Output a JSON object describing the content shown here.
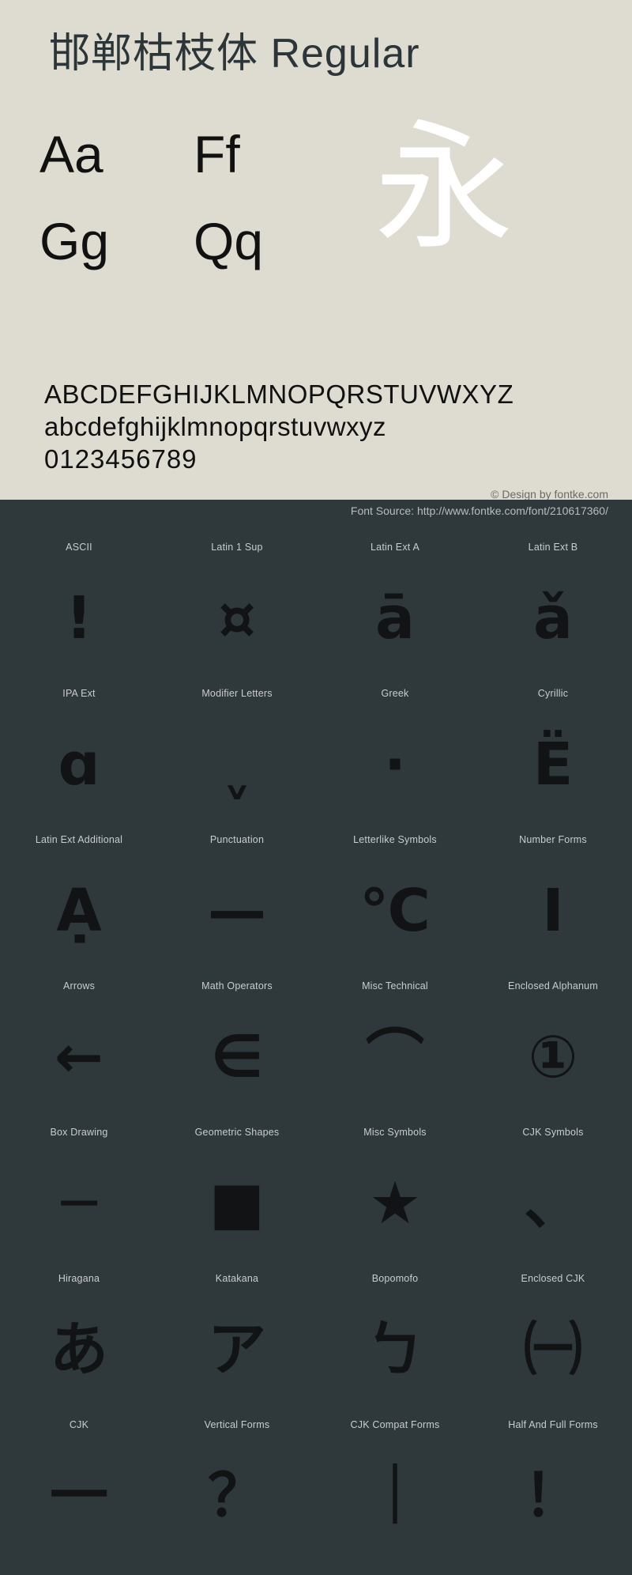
{
  "colors": {
    "light_bg": "#dedbd1",
    "dark_bg": "#2f383b",
    "glyph_dark": "#111315",
    "label_text": "#c9cdce",
    "credit_text": "#6a6a66",
    "showcase_glyph": "#ffffff"
  },
  "header": {
    "font_name": "邯郸枯枝体",
    "style_name": "Regular",
    "full_title": "邯郸枯枝体  Regular"
  },
  "samples": {
    "pairs": [
      "Aa",
      "Ff",
      "Gg",
      "Qq"
    ],
    "showcase_char": "永"
  },
  "alphabet": {
    "uppercase": "ABCDEFGHIJKLMNOPQRSTUVWXYZ",
    "lowercase": "abcdefghijklmnopqrstuvwxyz",
    "digits": "0123456789"
  },
  "credits": {
    "design": "© Design by fontke.com",
    "source": "Font Source: http://www.fontke.com/font/210617360/"
  },
  "unicode_blocks": [
    [
      {
        "label": "ASCII",
        "glyph": "!",
        "size": "normal"
      },
      {
        "label": "Latin 1 Sup",
        "glyph": "¤",
        "size": "normal"
      },
      {
        "label": "Latin Ext A",
        "glyph": "ā",
        "size": "normal"
      },
      {
        "label": "Latin Ext B",
        "glyph": "ǎ",
        "size": "normal"
      }
    ],
    [
      {
        "label": "IPA Ext",
        "glyph": "ɑ",
        "size": "normal"
      },
      {
        "label": "Modifier Letters",
        "glyph": "ˬ",
        "size": "normal"
      },
      {
        "label": "Greek",
        "glyph": "·",
        "size": "normal"
      },
      {
        "label": "Cyrillic",
        "glyph": "Ё",
        "size": "normal"
      }
    ],
    [
      {
        "label": "Latin Ext Additional",
        "glyph": "Ạ",
        "size": "normal"
      },
      {
        "label": "Punctuation",
        "glyph": "—",
        "size": "normal"
      },
      {
        "label": "Letterlike Symbols",
        "glyph": "℃",
        "size": "normal"
      },
      {
        "label": "Number Forms",
        "glyph": "Ⅰ",
        "size": "normal"
      }
    ],
    [
      {
        "label": "Arrows",
        "glyph": "←",
        "size": "normal"
      },
      {
        "label": "Math Operators",
        "glyph": "∈",
        "size": "normal"
      },
      {
        "label": "Misc Technical",
        "glyph": "⌒",
        "size": "normal"
      },
      {
        "label": "Enclosed Alphanum",
        "glyph": "①",
        "size": "normal"
      }
    ],
    [
      {
        "label": "Box Drawing",
        "glyph": "─",
        "size": "normal"
      },
      {
        "label": "Geometric Shapes",
        "glyph": "■",
        "size": "normal"
      },
      {
        "label": "Misc Symbols",
        "glyph": "★",
        "size": "normal"
      },
      {
        "label": "CJK Symbols",
        "glyph": "、",
        "size": "normal"
      }
    ],
    [
      {
        "label": "Hiragana",
        "glyph": "あ",
        "size": "normal"
      },
      {
        "label": "Katakana",
        "glyph": "ア",
        "size": "normal"
      },
      {
        "label": "Bopomofo",
        "glyph": "ㄅ",
        "size": "normal"
      },
      {
        "label": "Enclosed CJK",
        "glyph": "㈠",
        "size": "normal"
      }
    ],
    [
      {
        "label": "CJK",
        "glyph": "一",
        "size": "normal"
      },
      {
        "label": "Vertical Forms",
        "glyph": "？",
        "size": "normal"
      },
      {
        "label": "CJK Compat Forms",
        "glyph": "｜",
        "size": "normal"
      },
      {
        "label": "Half And Full Forms",
        "glyph": "！",
        "size": "normal"
      }
    ]
  ]
}
